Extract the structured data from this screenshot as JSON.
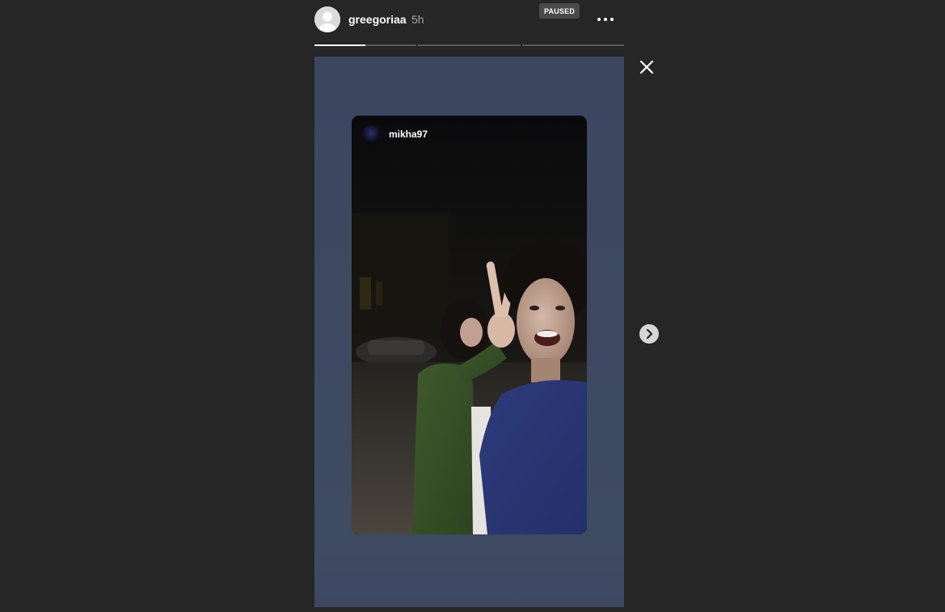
{
  "story": {
    "username": "greegoriaa",
    "time_ago": "5h",
    "status_badge": "PAUSED",
    "progress_segments": [
      {
        "fill": 0.5
      },
      {
        "fill": 0
      },
      {
        "fill": 0
      }
    ]
  },
  "reshare": {
    "username": "mikha97"
  },
  "icons": {
    "avatar": "default-avatar-icon",
    "more": "more-options-icon",
    "close": "close-icon",
    "next": "chevron-right-icon"
  },
  "colors": {
    "background": "#262626",
    "story_background": "#3c465f",
    "badge": "#4a4a4a"
  }
}
